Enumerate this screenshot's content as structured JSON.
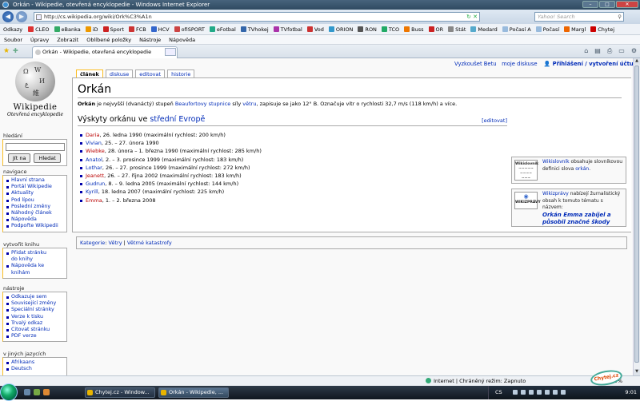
{
  "window": {
    "title": "Orkán - Wikipedie, otevřená encyklopedie - Windows Internet Explorer"
  },
  "address": {
    "url": "http://cs.wikipedia.org/wiki/Ork%C3%A1n",
    "search_placeholder": "Yahoo! Search"
  },
  "links_bar": {
    "label": "Odkazy",
    "items": [
      "CLEO",
      "eBanka",
      "iD",
      "Sport",
      "FCB",
      "HCV",
      "ofiSPORT",
      "eFotbal",
      "TVhokej",
      "TVfotbal",
      "Vod",
      "ORION",
      "RON",
      "TCO",
      "Buss",
      "OR",
      "Stát",
      "Medard",
      "Počasí A",
      "Počasí",
      "Margl",
      "Chytej"
    ],
    "colors": [
      "#d33",
      "#3a6",
      "#e90",
      "#c22",
      "#c33",
      "#36c",
      "#c44",
      "#2a8",
      "#36a",
      "#a3a",
      "#c33",
      "#39c",
      "#555",
      "#2a6",
      "#e70",
      "#c22",
      "#888",
      "#5ac",
      "#9bd",
      "#9bd",
      "#e60",
      "#c00"
    ]
  },
  "menu": [
    "Soubor",
    "Úpravy",
    "Zobrazit",
    "Oblíbené položky",
    "Nástroje",
    "Nápověda"
  ],
  "tab": {
    "title": "Orkán - Wikipedie, otevřená encyklopedie"
  },
  "logo": {
    "name": "Wikipedie",
    "subtitle": "Otevřená encyklopedie"
  },
  "personal": {
    "try_beta": "Vyzkoušet Betu",
    "my_discussion": "moje diskuse",
    "login": "Přihlášení / vytvoření účtu"
  },
  "content_tabs": [
    "článek",
    "diskuse",
    "editovat",
    "historie"
  ],
  "sidebar": {
    "search_title": "hledání",
    "go_button": "Jít na",
    "search_button": "Hledat",
    "nav_title": "navigace",
    "nav_items": [
      "Hlavní strana",
      "Portál Wikipedie",
      "Aktuality",
      "Pod lípou",
      "Poslední změny",
      "Náhodný článek",
      "Nápověda",
      "Podpořte Wikipedii"
    ],
    "book_title": "vytvořit knihu",
    "book_items": [
      "Přidat stránku do knihy",
      "Nápověda ke knihám"
    ],
    "tools_title": "nástroje",
    "tools_items": [
      "Odkazuje sem",
      "Související změny",
      "Speciální stránky",
      "Verze k tisku",
      "Trvalý odkaz",
      "Citovat stránku",
      "PDF verze"
    ],
    "lang_title": "v jiných jazycích",
    "lang_items": [
      "Afrikaans",
      "Deutsch"
    ]
  },
  "article": {
    "title": "Orkán",
    "intro_bold": "Orkán",
    "intro_1": " je nejvyšší (dvanáctý) stupeň ",
    "intro_link1": "Beaufortovy stupnice",
    "intro_2": " síly ",
    "intro_link2": "větru",
    "intro_3": ", zapisuje se jako 12° B. Označuje vítr o rychlosti 32,7 m/s (118 km/h) a více.",
    "section_prefix": "Výskyty orkánu ve ",
    "section_link": "střední Evropě",
    "edit_link": "[editovat]",
    "storms": [
      {
        "name": "Daria",
        "text": ", 26. ledna 1990 (maximální rychlost: 200 km/h)",
        "color": "#ba0000"
      },
      {
        "name": "Vivian",
        "text": ", 25. – 27. února 1990",
        "color": "#002bb8"
      },
      {
        "name": "Wiebke",
        "text": ", 28. února – 1. března 1990 (maximální rychlost: 285 km/h)",
        "color": "#ba0000"
      },
      {
        "name": "Anatol",
        "text": ", 2. – 3. prosince 1999 (maximální rychlost: 183 km/h)",
        "color": "#002bb8"
      },
      {
        "name": "Lothar",
        "text": ", 26. – 27. prosince 1999 (maximální rychlost: 272 km/h)",
        "color": "#002bb8"
      },
      {
        "name": "Jeanett",
        "text": ", 26. – 27. října 2002 (maximální rychlost: 183 km/h)",
        "color": "#ba0000"
      },
      {
        "name": "Gudrun",
        "text": ", 8. – 9. ledna 2005 (maximální rychlost: 144 km/h)",
        "color": "#002bb8"
      },
      {
        "name": "Kyrill",
        "text": ", 18. ledna 2007 (maximální rychlost: 225 km/h)",
        "color": "#002bb8"
      },
      {
        "name": "Emma",
        "text": ", 1. – 2. března 2008",
        "color": "#ba0000"
      }
    ],
    "categories_label": "Kategorie",
    "categories": [
      "Větry",
      "Větrné katastrofy"
    ]
  },
  "sidebox_wiktionary": {
    "img_label": "Wikislovník",
    "prefix": "Wikislovník",
    "text": " obsahuje slovníkovou definici slova ",
    "word": "orkán",
    "suffix": "."
  },
  "sidebox_wikinews": {
    "img_label": "WIKIZPRÁVY",
    "prefix": "Wikizprávy",
    "text": " nabízejí žurnalistický obsah k tomuto tématu s názvem:",
    "headline": "Orkán Emma zabíjel a působil značné škody"
  },
  "statusbar": {
    "zone": "Internet | Chráněný režim: Zapnuto",
    "zoom": "100%"
  },
  "taskbar": {
    "tasks": [
      "Chytej.cz - Window...",
      "Orkán - Wikipedie, ..."
    ],
    "lang": "CS",
    "time": "9:01"
  },
  "sticker": "Chytej.cz"
}
